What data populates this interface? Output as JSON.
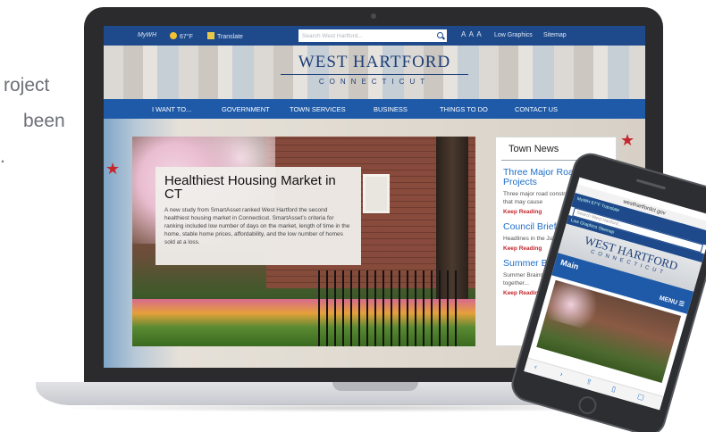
{
  "side_text": [
    "roject",
    "been",
    "."
  ],
  "site": {
    "utility": {
      "mywh": "MyWH",
      "weather": "67°F",
      "translate": "Translate",
      "search_placeholder": "Search West Hartford...",
      "text_size": "A A A",
      "low_graphics": "Low Graphics",
      "sitemap": "Sitemap"
    },
    "brand": {
      "title": "WEST HARTFORD",
      "subtitle": "CONNECTICUT"
    },
    "nav": [
      "I WANT TO...",
      "GOVERNMENT",
      "TOWN SERVICES",
      "BUSINESS",
      "THINGS TO DO",
      "CONTACT US"
    ],
    "hero": {
      "title": "Healthiest Housing Market in CT",
      "body": "A new study from SmartAsset ranked West Hartford the second healthiest housing market in Connecticut. SmartAsset’s criteria for ranking included low number of days on the market, length of time in the home, stable home prices, affordability, and the low number of homes sold at a loss."
    },
    "news": {
      "heading": "Town News",
      "articles": [
        {
          "title": "Three Major Road Projects",
          "body": "Three major road construction projects that may cause",
          "link": "Keep Reading"
        },
        {
          "title": "Council Briefs",
          "body": "Headlines in the July of Council Briefs...",
          "link": "Keep Reading"
        },
        {
          "title": "Summer Brainstorm",
          "body": "Summer Brainstorm education and re... together...",
          "link": "Keep Reading"
        }
      ]
    }
  },
  "phone": {
    "url": "westhartfordct.gov",
    "util": "MyWH   67°F   Translate",
    "search_placeholder": "Search West Hartford...",
    "links": "Low Graphics   Sitemap",
    "brand_title": "WEST HARTFORD",
    "brand_subtitle": "CONNECTICUT",
    "main_label": "Main",
    "menu_label": "MENU ☰"
  }
}
